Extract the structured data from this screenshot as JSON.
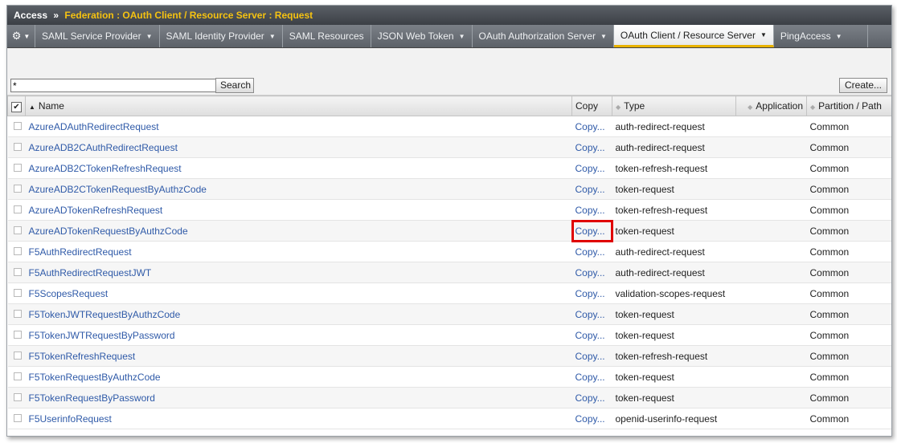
{
  "header": {
    "app": "Access",
    "separator": "»",
    "breadcrumb": "Federation : OAuth Client / Resource Server : Request"
  },
  "nav": {
    "tabs": [
      {
        "label": "SAML Service Provider",
        "dropdown": true
      },
      {
        "label": "SAML Identity Provider",
        "dropdown": true
      },
      {
        "label": "SAML Resources",
        "dropdown": false
      },
      {
        "label": "JSON Web Token",
        "dropdown": true
      },
      {
        "label": "OAuth Authorization Server",
        "dropdown": true
      },
      {
        "label": "OAuth Client / Resource Server",
        "dropdown": true,
        "active": true
      },
      {
        "label": "PingAccess",
        "dropdown": true
      }
    ]
  },
  "search": {
    "value": "*",
    "button_label": "Search"
  },
  "create_label": "Create...",
  "table": {
    "columns": {
      "name": "Name",
      "copy": "Copy",
      "type": "Type",
      "application": "Application",
      "partition": "Partition / Path"
    },
    "rows": [
      {
        "name": "AzureADAuthRedirectRequest",
        "copy": "Copy...",
        "type": "auth-redirect-request",
        "partition": "Common"
      },
      {
        "name": "AzureADB2CAuthRedirectRequest",
        "copy": "Copy...",
        "type": "auth-redirect-request",
        "partition": "Common"
      },
      {
        "name": "AzureADB2CTokenRefreshRequest",
        "copy": "Copy...",
        "type": "token-refresh-request",
        "partition": "Common"
      },
      {
        "name": "AzureADB2CTokenRequestByAuthzCode",
        "copy": "Copy...",
        "type": "token-request",
        "partition": "Common"
      },
      {
        "name": "AzureADTokenRefreshRequest",
        "copy": "Copy...",
        "type": "token-refresh-request",
        "partition": "Common"
      },
      {
        "name": "AzureADTokenRequestByAuthzCode",
        "copy": "Copy...",
        "type": "token-request",
        "partition": "Common",
        "highlighted": true
      },
      {
        "name": "F5AuthRedirectRequest",
        "copy": "Copy...",
        "type": "auth-redirect-request",
        "partition": "Common"
      },
      {
        "name": "F5AuthRedirectRequestJWT",
        "copy": "Copy...",
        "type": "auth-redirect-request",
        "partition": "Common"
      },
      {
        "name": "F5ScopesRequest",
        "copy": "Copy...",
        "type": "validation-scopes-request",
        "partition": "Common"
      },
      {
        "name": "F5TokenJWTRequestByAuthzCode",
        "copy": "Copy...",
        "type": "token-request",
        "partition": "Common"
      },
      {
        "name": "F5TokenJWTRequestByPassword",
        "copy": "Copy...",
        "type": "token-request",
        "partition": "Common"
      },
      {
        "name": "F5TokenRefreshRequest",
        "copy": "Copy...",
        "type": "token-refresh-request",
        "partition": "Common"
      },
      {
        "name": "F5TokenRequestByAuthzCode",
        "copy": "Copy...",
        "type": "token-request",
        "partition": "Common"
      },
      {
        "name": "F5TokenRequestByPassword",
        "copy": "Copy...",
        "type": "token-request",
        "partition": "Common"
      },
      {
        "name": "F5UserinfoRequest",
        "copy": "Copy...",
        "type": "openid-userinfo-request",
        "partition": "Common"
      }
    ]
  },
  "colors": {
    "breadcrumb": "#f5c211",
    "link": "#2f5aa8",
    "highlight": "#e00000",
    "active_tab_underline": "#e8b200"
  },
  "icons": {
    "gear": "gear-icon",
    "caret": "caret-down-icon",
    "sort_up": "sort-ascending-icon",
    "sort_both": "sort-icon",
    "check": "checkbox-icon"
  }
}
